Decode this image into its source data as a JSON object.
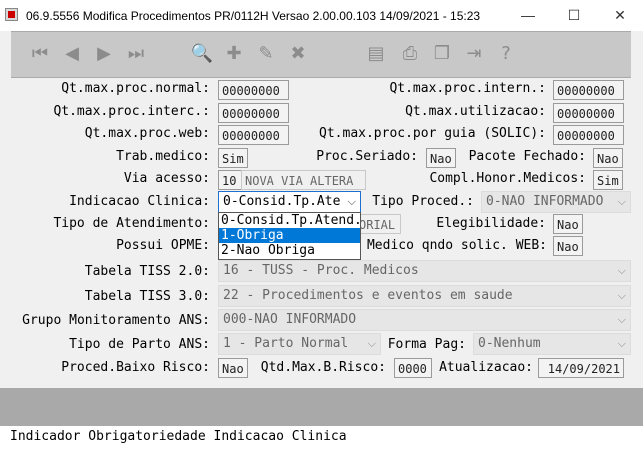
{
  "window": {
    "title": "06.9.5556  Modifica  Procedimentos PR/0112H Versao 2.00.00.103 14/09/2021 - 15:23",
    "minimize": "—",
    "maximize": "☐",
    "close": "✕"
  },
  "toolbar": {
    "buttons": [
      "first-icon",
      "prev-icon",
      "next-icon",
      "last-icon",
      "search-icon",
      "add-icon",
      "edit-icon",
      "delete-icon",
      "filter-icon",
      "print-icon",
      "copy-icon",
      "exit-icon",
      "help-icon"
    ]
  },
  "form": {
    "qt_max_proc_normal": {
      "label": "Qt.max.proc.normal:",
      "value": "00000000"
    },
    "qt_max_proc_intern": {
      "label": "Qt.max.proc.intern.:",
      "value": "00000000"
    },
    "qt_max_proc_interc": {
      "label": "Qt.max.proc.interc.:",
      "value": "00000000"
    },
    "qt_max_utilizacao": {
      "label": "Qt.max.utilizacao:",
      "value": "00000000"
    },
    "qt_max_proc_web": {
      "label": "Qt.max.proc.web:",
      "value": "00000000"
    },
    "qt_max_proc_guia": {
      "label": "Qt.max.proc.por guia (SOLIC):",
      "value": "00000000"
    },
    "trab_medico": {
      "label": "Trab.medico:",
      "value": "Sim"
    },
    "proc_seriado": {
      "label": "Proc.Seriado:",
      "value": "Nao"
    },
    "pacote_fechado": {
      "label": "Pacote Fechado:",
      "value": "Nao"
    },
    "via_acesso": {
      "label": "Via acesso:",
      "code": "10",
      "desc": "NOVA VIA ALTERA"
    },
    "compl_honor": {
      "label": "Compl.Honor.Medicos:",
      "value": "Sim"
    },
    "indicacao_clinica": {
      "label": "Indicacao Clinica:",
      "value": "0-Consid.Tp.Ate"
    },
    "tipo_proced": {
      "label": "Tipo Proced.:",
      "value": "0-NAO INFORMADO"
    },
    "tipo_atendimento": {
      "label": "Tipo de Atendimento:",
      "value": "ORIAL"
    },
    "elegibilidade": {
      "label": "Elegibilidade:",
      "value": "Nao"
    },
    "possui_opme": {
      "label": "Possui OPME:"
    },
    "medico_qndo": {
      "label": "Medico qndo solic. WEB:",
      "value": "Nao"
    },
    "tabela_tiss_20": {
      "label": "Tabela TISS 2.0:",
      "value": "16 - TUSS - Proc. Medicos"
    },
    "tabela_tiss_30": {
      "label": "Tabela TISS 3.0:",
      "value": "22 - Procedimentos e eventos em saude"
    },
    "grupo_monitoramento": {
      "label": "Grupo Monitoramento ANS:",
      "value": "000-NAO INFORMADO"
    },
    "tipo_parto": {
      "label": "Tipo de Parto ANS:",
      "value": "1 - Parto Normal"
    },
    "forma_pag": {
      "label": "Forma Pag:",
      "value": "0-Nenhum"
    },
    "proced_baixo_risco": {
      "label": "Proced.Baixo Risco:",
      "value": "Nao"
    },
    "qtd_max_b_risco": {
      "label": "Qtd.Max.B.Risco:",
      "value": "0000"
    },
    "atualizacao": {
      "label": "Atualizacao:",
      "value": "14/09/2021"
    }
  },
  "dropdown": {
    "options": [
      "0-Consid.Tp.Atend.",
      "1-Obriga",
      "2-Nao Obriga"
    ],
    "highlighted": "1-Obriga"
  },
  "status": {
    "text": "Indicador Obrigatoriedade Indicacao Clinica"
  },
  "colors": {
    "accent": "#0078d7",
    "toolbar": "#c8c8c8",
    "band": "#a9a9a9"
  }
}
